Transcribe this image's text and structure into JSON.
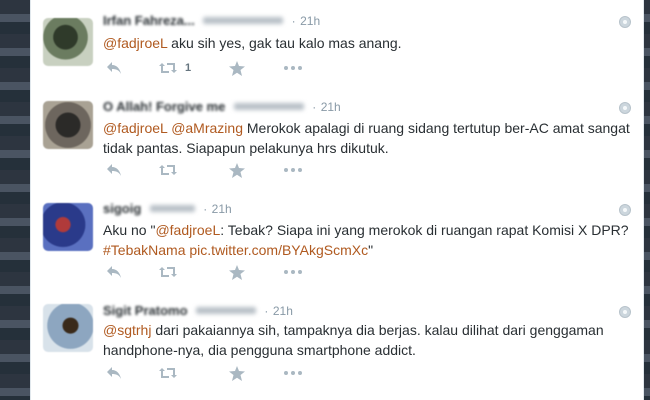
{
  "tweets": [
    {
      "fullname": "Irfan Fahreza...",
      "username": "@...joel",
      "time": "21h",
      "segments": [
        {
          "type": "mention",
          "text": "@fadjroeL"
        },
        {
          "type": "text",
          "text": " aku sih yes, gak tau kalo mas anang."
        }
      ],
      "retweet_count": "1",
      "avatar_color": "#5a6b52"
    },
    {
      "fullname": "O Allah! Forgive me",
      "username": "@...lekdo",
      "time": "21h",
      "segments": [
        {
          "type": "mention",
          "text": "@fadjroeL"
        },
        {
          "type": "text",
          "text": " "
        },
        {
          "type": "mention",
          "text": "@aMrazing"
        },
        {
          "type": "text",
          "text": " Merokok apalagi di ruang sidang tertutup ber-AC amat sangat tidak pantas. Siapapun pelakunya hrs dikutuk."
        }
      ],
      "retweet_count": "",
      "avatar_color": "#4a4640"
    },
    {
      "fullname": "sigoig",
      "username": "@sgtrhj",
      "time": "21h",
      "segments": [
        {
          "type": "text",
          "text": "Aku no \""
        },
        {
          "type": "mention",
          "text": "@fadjroeL"
        },
        {
          "type": "text",
          "text": ": Tebak? Siapa ini yang merokok di ruangan rapat Komisi X DPR? "
        },
        {
          "type": "hashtag",
          "text": "#TebakNama"
        },
        {
          "type": "text",
          "text": " "
        },
        {
          "type": "link",
          "text": "pic.twitter.com/BYAkgScmXc"
        },
        {
          "type": "text",
          "text": "\""
        }
      ],
      "retweet_count": "",
      "avatar_color": "#3a4e9a"
    },
    {
      "fullname": "Sigit Pratomo",
      "username": "@...mendu",
      "time": "21h",
      "segments": [
        {
          "type": "mention",
          "text": "@sgtrhj"
        },
        {
          "type": "text",
          "text": " dari pakaiannya sih, tampaknya dia berjas. kalau dilihat dari genggaman handphone-nya, dia pengguna smartphone addict."
        }
      ],
      "retweet_count": "",
      "avatar_color": "#6d8aa8"
    }
  ],
  "colors": {
    "link": "#b05a20",
    "text": "#292f33",
    "muted": "#8899a6",
    "icon": "#aab8c2"
  },
  "icons": {
    "reply": "reply-icon",
    "retweet": "retweet-icon",
    "favorite": "star-icon",
    "more": "more-icon",
    "caret": "dropdown-caret-icon"
  }
}
